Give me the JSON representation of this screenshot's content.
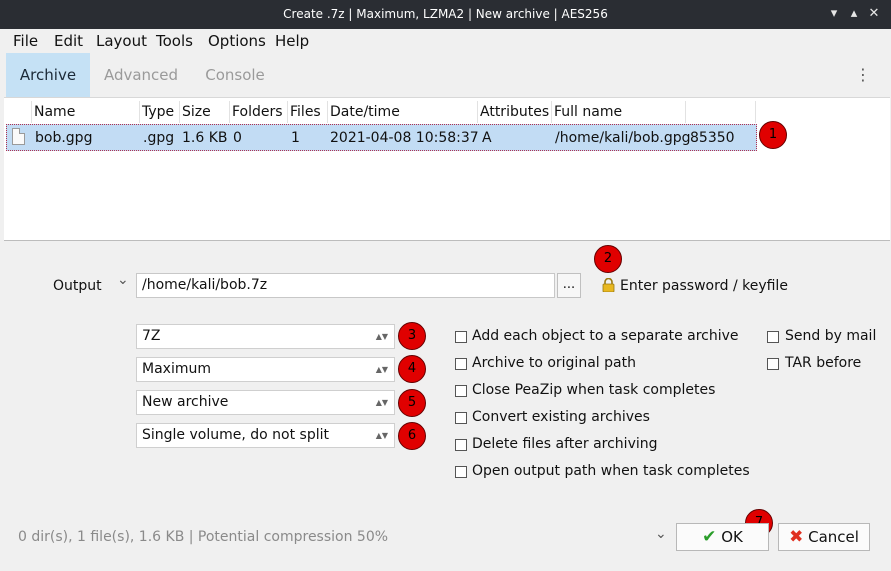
{
  "window": {
    "title": "Create .7z | Maximum, LZMA2 | New archive | AES256",
    "controls": [
      "▾",
      "▴",
      "✕"
    ]
  },
  "menu": [
    "File",
    "Edit",
    "Layout",
    "Tools",
    "Options",
    "Help"
  ],
  "tabs": [
    "Archive",
    "Advanced",
    "Console"
  ],
  "kebab": "⋮",
  "filelist": {
    "columns": [
      "Name",
      "Type",
      "Size",
      "Folders",
      "Files",
      "Date/time",
      "Attributes",
      "Full name"
    ],
    "row": {
      "name": "bob.gpg",
      "type": ".gpg",
      "size": "1.6 KB",
      "folders": "0",
      "files": "1",
      "datetime": "2021-04-08 10:58:37",
      "attributes": "A",
      "fullname": "/home/kali/bob.gpg",
      "extra": "85350"
    }
  },
  "output": {
    "label": "Output",
    "caret": "⌄",
    "path": "/home/kali/bob.7z",
    "browse": "...",
    "password_label": "Enter password / keyfile"
  },
  "selects": {
    "format": "7Z",
    "level": "Maximum",
    "mode": "New archive",
    "split": "Single volume, do not split",
    "arrow": "▲▼"
  },
  "options": {
    "separate": "Add each object to a separate archive",
    "original": "Archive to original path",
    "close": "Close PeaZip when task completes",
    "convert": "Convert existing archives",
    "delete": "Delete files after archiving",
    "open": "Open output path when task completes",
    "mail": "Send by mail",
    "tar": "TAR before"
  },
  "badges": [
    "1",
    "2",
    "3",
    "4",
    "5",
    "6",
    "7"
  ],
  "status": "0 dir(s), 1 file(s), 1.6 KB | Potential compression 50%",
  "footer": {
    "dropdown": "⌄",
    "ok": "OK",
    "cancel": "Cancel"
  },
  "colors": {
    "titlebar": "#2a2d33",
    "tab_active": "#c5e1f5",
    "row_selected": "#c2dcf4",
    "badge": "#e00000",
    "ok_check": "#2a9d2a",
    "cancel_x": "#e03020"
  }
}
